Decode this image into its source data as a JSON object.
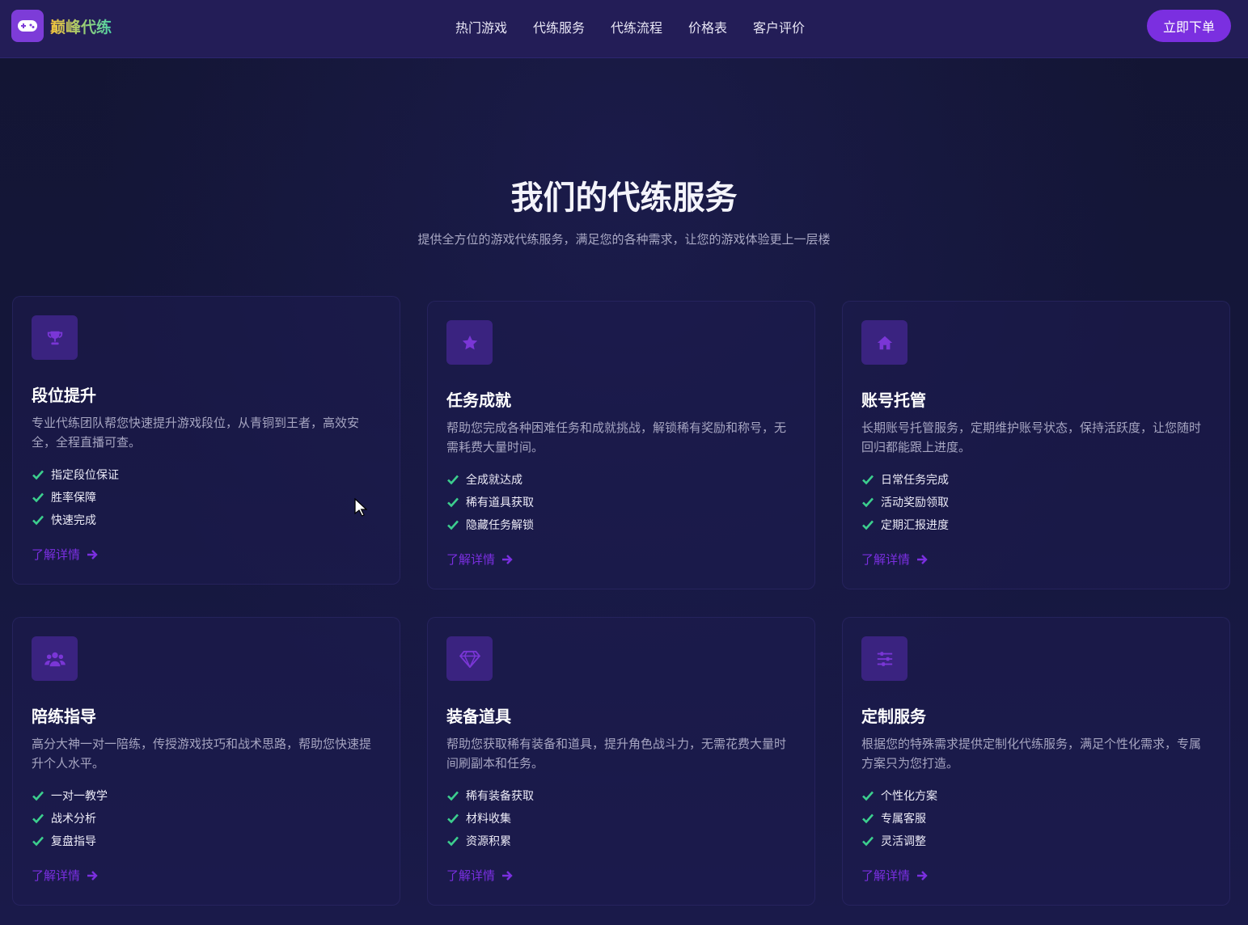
{
  "brand": {
    "name": "巅峰代练",
    "logo_icon": "gamepad-icon"
  },
  "nav": {
    "items": [
      "热门游戏",
      "代练服务",
      "代练流程",
      "价格表",
      "客户评价"
    ],
    "order_button": "立即下单"
  },
  "hero": {
    "title": "我们的代练服务",
    "subtitle": "提供全方位的游戏代练服务，满足您的各种需求，让您的游戏体验更上一层楼"
  },
  "colors": {
    "accent": "#7b2fe0",
    "check": "#3ccf8e",
    "nav_bg": "#231d57",
    "page_bg": "#111232"
  },
  "services": [
    {
      "icon": "trophy-icon",
      "title": "段位提升",
      "desc": "专业代练团队帮您快速提升游戏段位，从青铜到王者，高效安全，全程直播可查。",
      "features": [
        "指定段位保证",
        "胜率保障",
        "快速完成"
      ],
      "more": "了解详情"
    },
    {
      "icon": "star-icon",
      "title": "任务成就",
      "desc": "帮助您完成各种困难任务和成就挑战，解锁稀有奖励和称号，无需耗费大量时间。",
      "features": [
        "全成就达成",
        "稀有道具获取",
        "隐藏任务解锁"
      ],
      "more": "了解详情"
    },
    {
      "icon": "home-icon",
      "title": "账号托管",
      "desc": "长期账号托管服务，定期维护账号状态，保持活跃度，让您随时回归都能跟上进度。",
      "features": [
        "日常任务完成",
        "活动奖励领取",
        "定期汇报进度"
      ],
      "more": "了解详情"
    },
    {
      "icon": "users-icon",
      "title": "陪练指导",
      "desc": "高分大神一对一陪练，传授游戏技巧和战术思路，帮助您快速提升个人水平。",
      "features": [
        "一对一教学",
        "战术分析",
        "复盘指导"
      ],
      "more": "了解详情"
    },
    {
      "icon": "gem-icon",
      "title": "装备道具",
      "desc": "帮助您获取稀有装备和道具，提升角色战斗力，无需花费大量时间刷副本和任务。",
      "features": [
        "稀有装备获取",
        "材料收集",
        "资源积累"
      ],
      "more": "了解详情"
    },
    {
      "icon": "sliders-icon",
      "title": "定制服务",
      "desc": "根据您的特殊需求提供定制化代练服务，满足个性化需求，专属方案只为您打造。",
      "features": [
        "个性化方案",
        "专属客服",
        "灵活调整"
      ],
      "more": "了解详情"
    }
  ]
}
